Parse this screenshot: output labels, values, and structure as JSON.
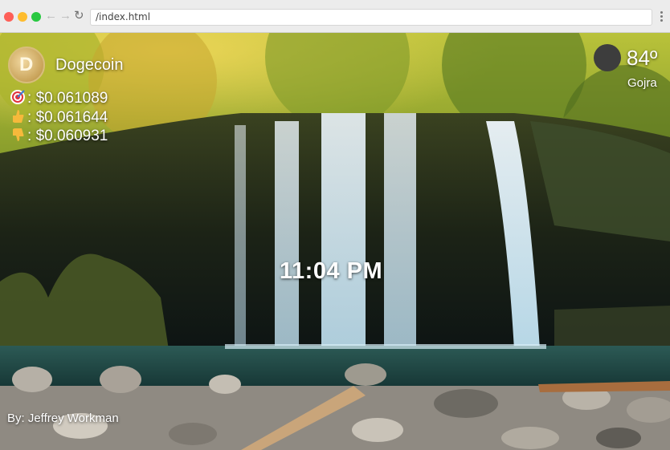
{
  "browser": {
    "url": "/index.html",
    "icons": {
      "back": "arrow-left-icon",
      "forward": "arrow-right-icon",
      "reload": "reload-icon",
      "menu": "kebab-menu-icon"
    }
  },
  "coin": {
    "logo_letter": "D",
    "name": "Dogecoin",
    "prices": [
      {
        "icon": "target-icon",
        "value": "$0.061089"
      },
      {
        "icon": "thumbs-up-icon",
        "value": "$0.061644"
      },
      {
        "icon": "thumbs-down-icon",
        "value": "$0.060931"
      }
    ],
    "separator": ":"
  },
  "weather": {
    "temperature": "84º",
    "city": "Gojra",
    "icon": "weather-icon"
  },
  "clock": {
    "time": "11:04 PM"
  },
  "footer": {
    "author": "By: Jeffrey Workman"
  },
  "colors": {
    "traffic_red": "#fe5f57",
    "traffic_yellow": "#febc2e",
    "traffic_green": "#28c840"
  }
}
